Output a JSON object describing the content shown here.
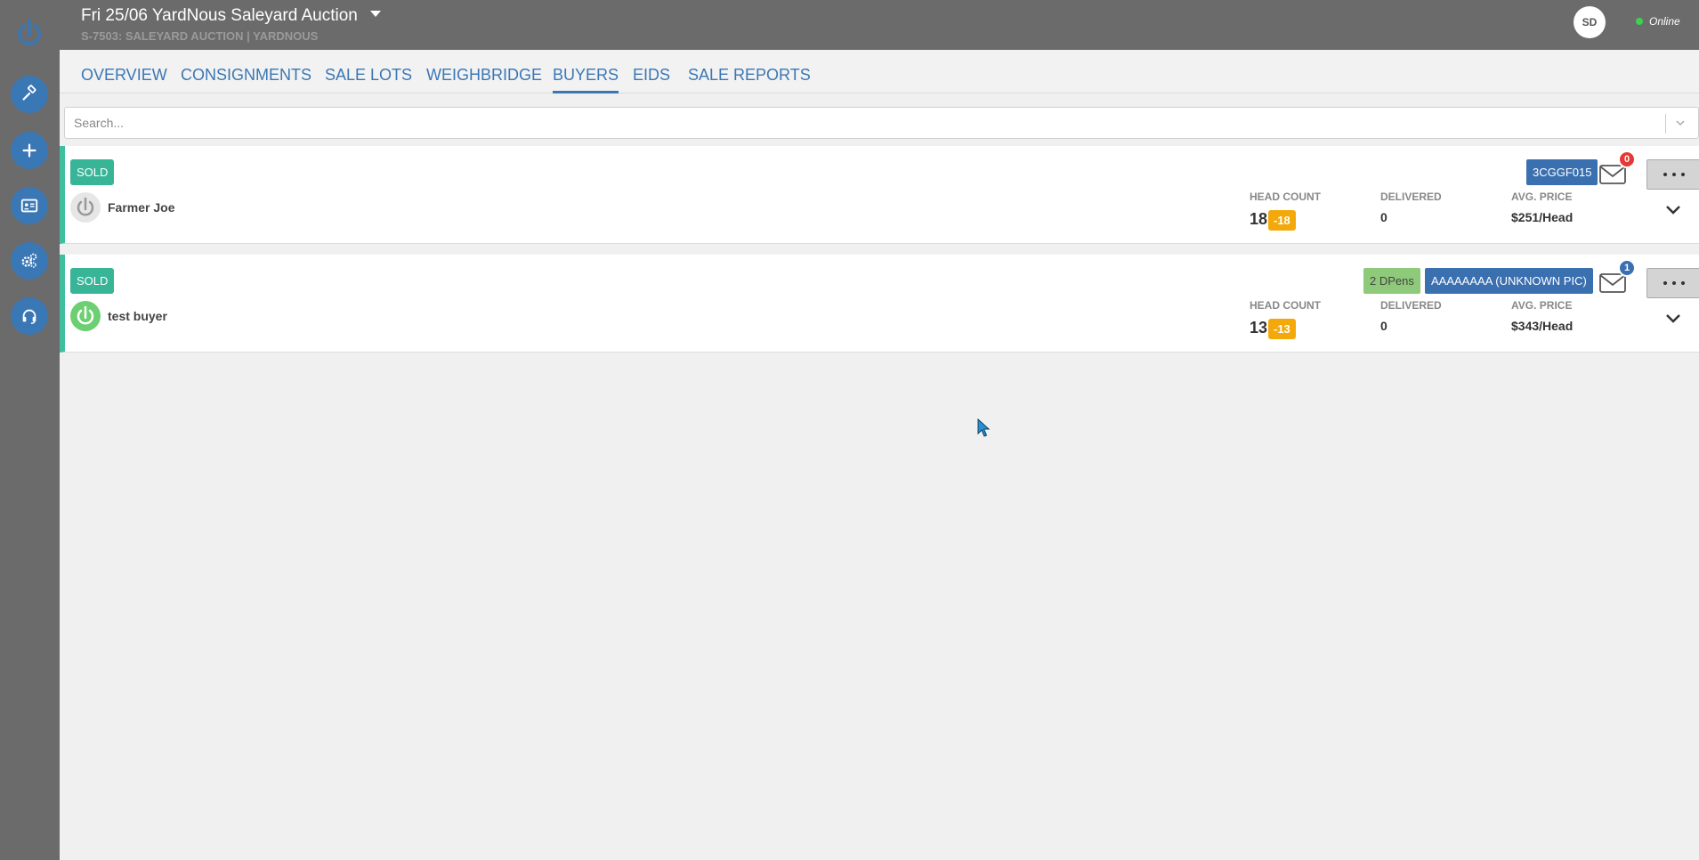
{
  "header": {
    "title": "Fri 25/06 YardNous Saleyard Auction",
    "subtitle": "S-7503: SALEYARD AUCTION | YARDNOUS",
    "avatar_initials": "SD",
    "status": "Online",
    "status_color": "#3fd14d"
  },
  "sidebar": {
    "items": [
      {
        "icon": "gavel-icon"
      },
      {
        "icon": "plus-icon"
      },
      {
        "icon": "id-card-icon"
      },
      {
        "icon": "gears-icon"
      },
      {
        "icon": "headset-icon"
      }
    ]
  },
  "tabs": [
    {
      "label": "OVERVIEW"
    },
    {
      "label": "CONSIGNMENTS"
    },
    {
      "label": "SALE LOTS"
    },
    {
      "label": "WEIGHBRIDGE"
    },
    {
      "label": "BUYERS",
      "active": true
    },
    {
      "label": "EIDS"
    },
    {
      "label": "SALE REPORTS"
    }
  ],
  "search": {
    "placeholder": "Search..."
  },
  "labels": {
    "head_count": "HEAD COUNT",
    "delivered": "DELIVERED",
    "avg_price": "AVG. PRICE"
  },
  "buyers": [
    {
      "status": "SOLD",
      "name": "Farmer Joe",
      "head_count": "18",
      "head_count_delta": "-18",
      "delivered": "0",
      "avg_price": "$251/Head",
      "pic_tag": "3CGGF015",
      "mail_count": "0",
      "mail_badge_color": "#e53935"
    },
    {
      "status": "SOLD",
      "name": "test buyer",
      "head_count": "13",
      "head_count_delta": "-13",
      "delivered": "0",
      "avg_price": "$343/Head",
      "pens_tag": "2 DPens",
      "pic_tag": "AAAAAAAA (UNKNOWN PIC)",
      "mail_count": "1",
      "mail_badge_color": "#3a6fb0"
    }
  ],
  "colors": {
    "accent": "#3a77b5",
    "sold": "#38b497",
    "warning": "#f3a90c",
    "chrome": "#6b6b6b"
  }
}
